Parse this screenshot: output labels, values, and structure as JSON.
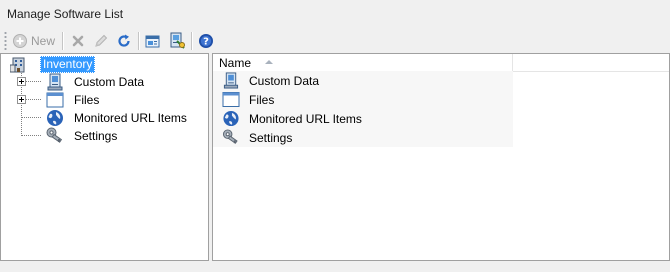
{
  "window": {
    "title": "Manage Software List"
  },
  "toolbar": {
    "new_label": "New",
    "buttons": [
      {
        "icon": "add-circle-icon",
        "label": "New",
        "enabled": false
      },
      {
        "icon": "delete-x-icon",
        "enabled": false
      },
      {
        "icon": "edit-pencil-icon",
        "enabled": false
      },
      {
        "icon": "refresh-icon",
        "enabled": true
      },
      {
        "icon": "export-icon",
        "enabled": true
      },
      {
        "icon": "computer-sync-icon",
        "enabled": true
      },
      {
        "icon": "help-icon",
        "enabled": true
      }
    ]
  },
  "tree": {
    "root": {
      "label": "Inventory",
      "icon": "inventory-building-icon",
      "selected": true
    },
    "children": [
      {
        "label": "Custom Data",
        "icon": "custom-data-icon",
        "expandable": true
      },
      {
        "label": "Files",
        "icon": "files-window-icon",
        "expandable": true
      },
      {
        "label": "Monitored URL Items",
        "icon": "globe-icon",
        "expandable": false
      },
      {
        "label": "Settings",
        "icon": "settings-key-icon",
        "expandable": false
      }
    ]
  },
  "list": {
    "column_name": "Name",
    "sort": "ascending",
    "rows": [
      {
        "label": "Custom Data",
        "icon": "custom-data-icon"
      },
      {
        "label": "Files",
        "icon": "files-window-icon"
      },
      {
        "label": "Monitored URL Items",
        "icon": "globe-icon"
      },
      {
        "label": "Settings",
        "icon": "settings-key-icon"
      }
    ]
  },
  "colors": {
    "selection": "#3399ff",
    "background": "#f0f0f0",
    "panel_border": "#a0a0a0"
  }
}
